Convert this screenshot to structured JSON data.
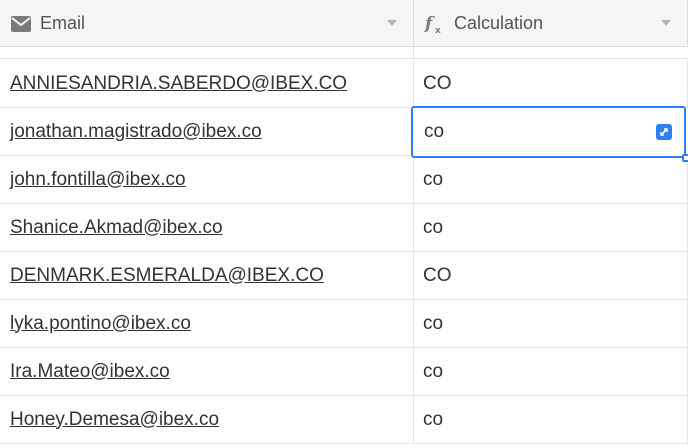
{
  "header": {
    "email_label": "Email",
    "calc_label": "Calculation",
    "email_icon": "envelope-icon",
    "calc_icon": "formula-icon"
  },
  "rows": [
    {
      "email": "ANNIESANDRIA.SABERDO@IBEX.CO",
      "calc": "CO"
    },
    {
      "email": "jonathan.magistrado@ibex.co",
      "calc": "co"
    },
    {
      "email": "john.fontilla@ibex.co",
      "calc": "co"
    },
    {
      "email": "Shanice.Akmad@ibex.co",
      "calc": "co"
    },
    {
      "email": "DENMARK.ESMERALDA@IBEX.CO",
      "calc": "CO"
    },
    {
      "email": "lyka.pontino@ibex.co",
      "calc": "co"
    },
    {
      "email": "Ira.Mateo@ibex.co",
      "calc": "co"
    },
    {
      "email": "Honey.Demesa@ibex.co",
      "calc": "co"
    }
  ],
  "selected_row_index": 1,
  "colors": {
    "accent": "#2d7ff9",
    "header_bg": "#f5f5f5",
    "border": "#e6e6e6"
  }
}
